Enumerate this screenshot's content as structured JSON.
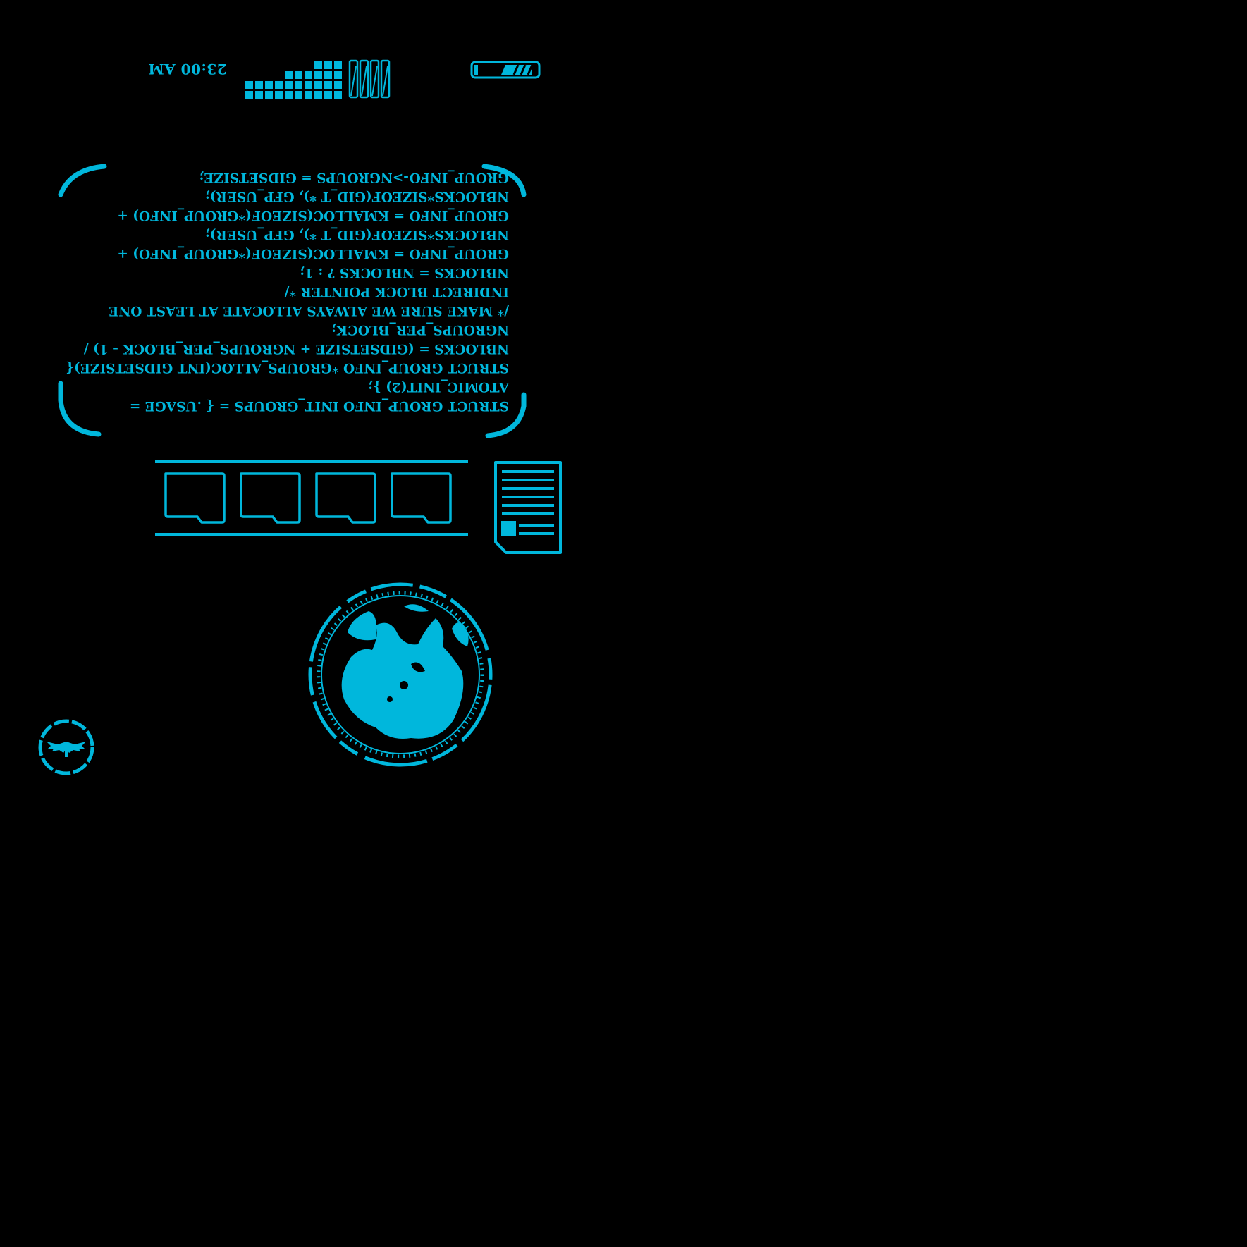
{
  "status_bar": {
    "time": "23:00 AM",
    "signal_icon": "signal-grid-icon",
    "bars_icon": "striped-bars-icon",
    "battery_icon": "battery-icon"
  },
  "code_panel": {
    "lines": [
      "STRUCT GROUP_INFO INIT_GROUPS = { .USAGE =",
      "ATOMIC_INIT(2) };",
      "STRUCT GROUP_INFO *GROUPS_ALLOC(INT GIDSETSIZE){",
      "NBLOCKS = (GIDSETSIZE + NGROUPS_PER_BLOCK - 1) /",
      "NGROUPS_PER_BLOCK;",
      "/* MAKE SURE WE ALWAYS ALLOCATE AT LEAST ONE",
      "INDIRECT BLOCK POINTER */",
      "NBLOCKS = NBLOCKS ? : 1;",
      "GROUP_INFO = KMALLOC(SIZEOF(*GROUP_INFO) +",
      "NBLOCKS*SIZEOF(GID_T *), GFP_USER);",
      "GROUP_INFO = KMALLOC(SIZEOF(*GROUP_INFO) +",
      "NBLOCKS*SIZEOF(GID_T *), GFP_USER);",
      "GROUP_INFO->NGROUPS = GIDSETSIZE;"
    ]
  },
  "monitors": {
    "count": 4,
    "icon": "monitor-icon"
  },
  "document_icon": "document-icon",
  "globe_icon": "globe-icon",
  "emblem_icon": "winged-emblem-icon",
  "colors": {
    "accent": "#00b7dc",
    "background": "#000000"
  }
}
